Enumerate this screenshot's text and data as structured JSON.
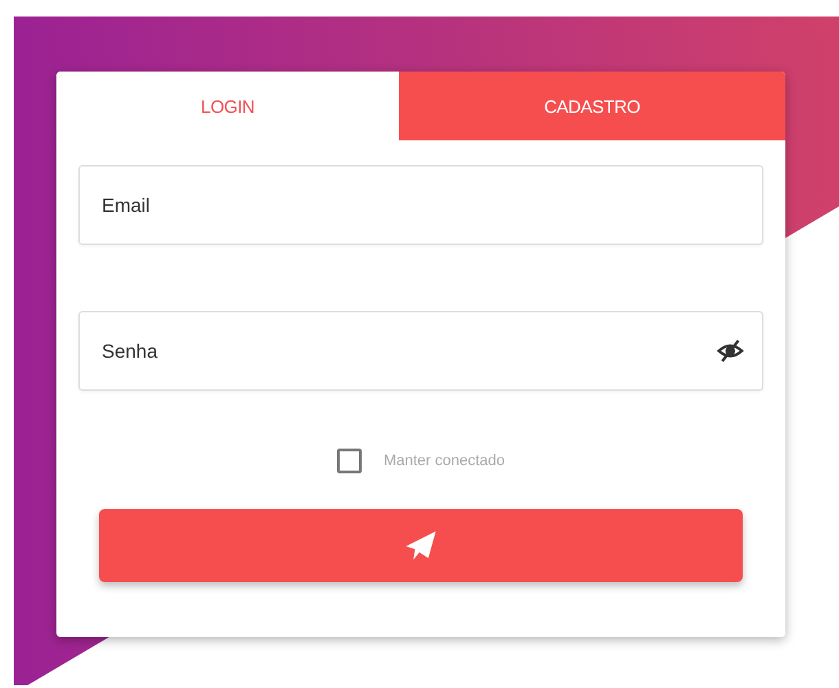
{
  "tabs": [
    {
      "label": "LOGIN",
      "selected": true
    },
    {
      "label": "CADASTRO",
      "selected": false
    }
  ],
  "fields": [
    {
      "placeholder": "Email",
      "kind": "text"
    },
    {
      "placeholder": "Senha",
      "kind": "password"
    }
  ],
  "remember": {
    "label": "Manter conectado",
    "checked": false
  }
}
